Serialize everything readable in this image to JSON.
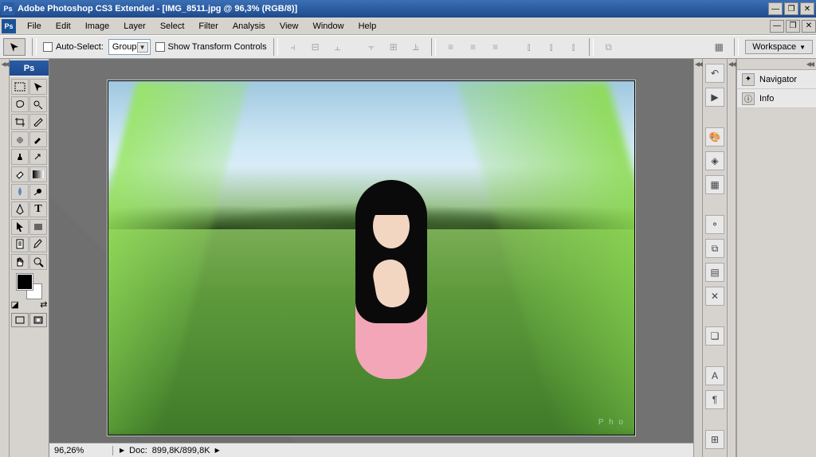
{
  "titlebar": {
    "app_name": "Adobe Photoshop CS3 Extended",
    "document": "[IMG_8511.jpg @ 96,3% (RGB/8)]"
  },
  "menu": [
    "File",
    "Edit",
    "Image",
    "Layer",
    "Select",
    "Filter",
    "Analysis",
    "View",
    "Window",
    "Help"
  ],
  "options": {
    "auto_select_label": "Auto-Select:",
    "auto_select_value": "Group",
    "show_transform": "Show Transform Controls",
    "workspace": "Workspace"
  },
  "toolbox_header": "Ps",
  "palettes": {
    "navigator": "Navigator",
    "info": "Info"
  },
  "status": {
    "zoom": "96,26%",
    "doc_label": "Doc:",
    "doc_value": "899,8K/899,8K"
  },
  "canvas": {
    "watermark": "P h o"
  }
}
